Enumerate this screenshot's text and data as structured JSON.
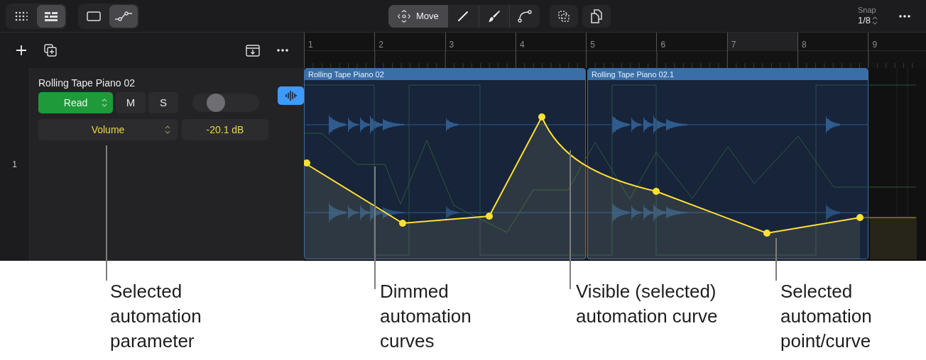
{
  "toolbar": {
    "view_buttons": [
      {
        "selected": false
      },
      {
        "selected": true
      }
    ],
    "mode_buttons": [
      {
        "selected": false
      },
      {
        "selected": true
      }
    ],
    "tools": [
      {
        "label": "Move",
        "selected": true
      },
      {
        "selected": false
      },
      {
        "selected": false
      },
      {
        "selected": false
      }
    ],
    "snap": {
      "label": "Snap",
      "value": "1/8"
    }
  },
  "track": {
    "number": "1",
    "name": "Rolling Tape Piano 02",
    "automation_mode": "Read",
    "mute": {
      "label": "M",
      "on": false
    },
    "solo": {
      "label": "S",
      "on": false
    },
    "slider": {
      "level": 0.3
    },
    "waveform_button": {
      "on": true
    },
    "parameter": "Volume",
    "value": "-20.1 dB"
  },
  "ruler": {
    "bars": [
      "1",
      "2",
      "3",
      "4",
      "5",
      "6",
      "7",
      "8",
      "9"
    ]
  },
  "regions": [
    {
      "name": "Rolling Tape Piano 02"
    },
    {
      "name": "Rolling Tape Piano 02.1"
    }
  ],
  "callouts": [
    {
      "lines": [
        "Selected",
        "automation",
        "parameter"
      ]
    },
    {
      "lines": [
        "Dimmed",
        "automation",
        "curves"
      ]
    },
    {
      "lines": [
        "Visible (selected)",
        "automation curve"
      ]
    },
    {
      "lines": [
        "Selected",
        "automation",
        "point/curve"
      ]
    }
  ]
}
